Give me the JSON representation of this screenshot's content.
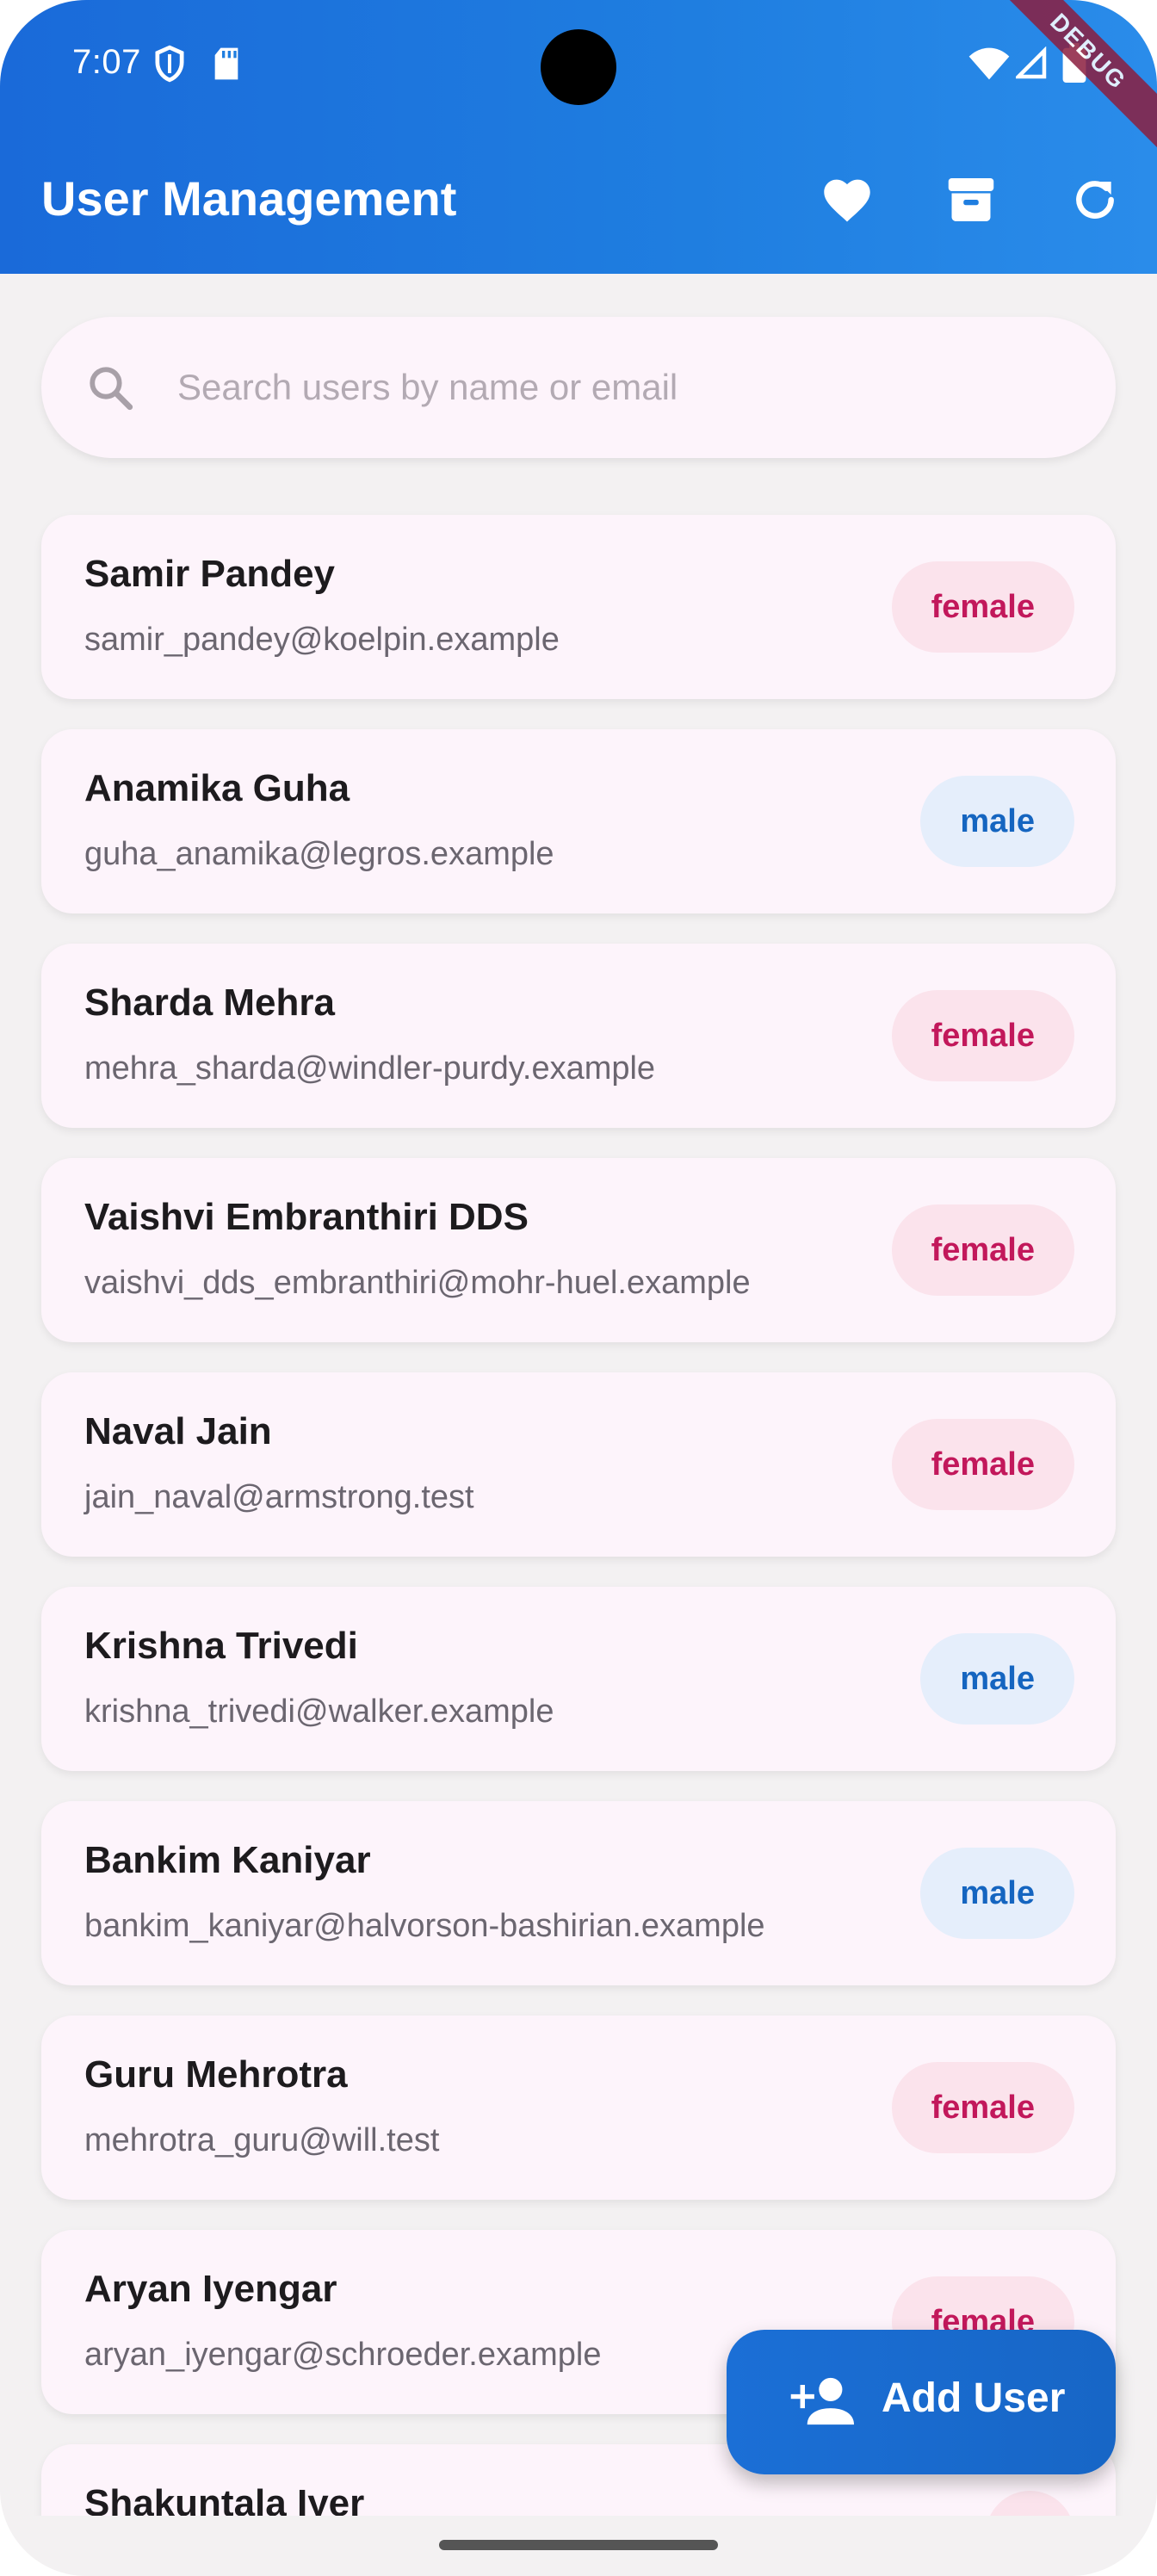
{
  "status_bar": {
    "time": "7:07",
    "icons": [
      "shield-icon",
      "sd-card-icon",
      "wifi-icon",
      "signal-icon",
      "battery-icon"
    ],
    "debug_banner": "DEBUG"
  },
  "app_bar": {
    "title": "User Management",
    "background_color": "#1f7ee0",
    "actions": [
      {
        "name": "favorites",
        "icon": "heart-icon"
      },
      {
        "name": "archive",
        "icon": "archive-icon"
      },
      {
        "name": "refresh",
        "icon": "refresh-icon"
      }
    ]
  },
  "search": {
    "placeholder": "Search users by name or email",
    "value": ""
  },
  "users": [
    {
      "name": "Samir Pandey",
      "email": "samir_pandey@koelpin.example",
      "gender": "female"
    },
    {
      "name": "Anamika Guha",
      "email": "guha_anamika@legros.example",
      "gender": "male"
    },
    {
      "name": "Sharda Mehra",
      "email": "mehra_sharda@windler-purdy.example",
      "gender": "female"
    },
    {
      "name": "Vaishvi Embranthiri DDS",
      "email": "vaishvi_dds_embranthiri@mohr-huel.example",
      "gender": "female"
    },
    {
      "name": "Naval Jain",
      "email": "jain_naval@armstrong.test",
      "gender": "female"
    },
    {
      "name": "Krishna Trivedi",
      "email": "krishna_trivedi@walker.example",
      "gender": "male"
    },
    {
      "name": "Bankim Kaniyar",
      "email": "bankim_kaniyar@halvorson-bashirian.example",
      "gender": "male"
    },
    {
      "name": "Guru Mehrotra",
      "email": "mehrotra_guru@will.test",
      "gender": "female"
    },
    {
      "name": "Aryan Iyengar",
      "email": "aryan_iyengar@schroeder.example",
      "gender": "female"
    },
    {
      "name": "Shakuntala Iyer",
      "email": "",
      "gender": ""
    }
  ],
  "colors": {
    "female_chip_bg": "#fbe3ec",
    "female_chip_text": "#c2185b",
    "male_chip_bg": "#e5eefb",
    "male_chip_text": "#1565c0"
  },
  "fab": {
    "label": "Add User",
    "icon": "add-person-icon"
  }
}
